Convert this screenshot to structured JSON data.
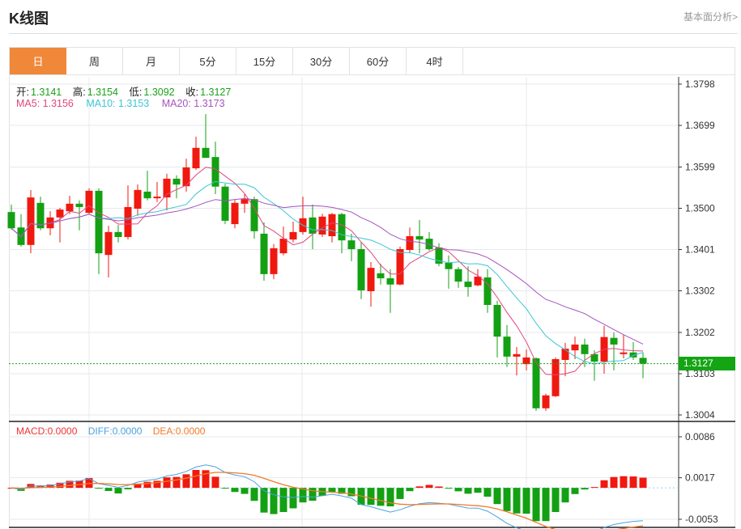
{
  "header": {
    "title": "K线图",
    "link": "基本面分析>"
  },
  "tabs": [
    {
      "label": "日",
      "active": true
    },
    {
      "label": "周"
    },
    {
      "label": "月"
    },
    {
      "label": "5分"
    },
    {
      "label": "15分"
    },
    {
      "label": "30分"
    },
    {
      "label": "60分"
    },
    {
      "label": "4时"
    }
  ],
  "ohlc_info": {
    "open_label": "开:",
    "open": "1.3141",
    "high_label": "高:",
    "high": "1.3154",
    "low_label": "低:",
    "low": "1.3092",
    "close_label": "收:",
    "close": "1.3127"
  },
  "ma_info": {
    "ma5": "MA5: 1.3156",
    "ma10": "MA10: 1.3153",
    "ma20": "MA20: 1.3173"
  },
  "macd_info": {
    "macd": "MACD:0.0000",
    "diff": "DIFF:0.0000",
    "dea": "DEA:0.0000"
  },
  "current_price": "1.3127",
  "colors": {
    "up": "#f0190f",
    "down": "#13a013",
    "ma5": "#e0467f",
    "ma10": "#3cc5d5",
    "ma20": "#a453c0",
    "diff": "#4aa3df",
    "dea": "#f07a2a",
    "active_tab": "#f0883a"
  },
  "chart_data": {
    "type": "candlestick",
    "price_axis_ticks": [
      "1.3798",
      "1.3699",
      "1.3599",
      "1.3500",
      "1.3401",
      "1.3302",
      "1.3202",
      "1.3103",
      "1.3004"
    ],
    "price_range": [
      1.3004,
      1.3798
    ],
    "macd_axis_ticks": [
      "0.0086",
      "0.0017",
      "-0.0053"
    ],
    "macd_range": [
      -0.0053,
      0.0086
    ],
    "candles_ohlc": [
      [
        1.3491,
        1.3509,
        1.3449,
        1.3452
      ],
      [
        1.3454,
        1.3486,
        1.3408,
        1.3412
      ],
      [
        1.3412,
        1.3544,
        1.3392,
        1.3526
      ],
      [
        1.3513,
        1.3528,
        1.3447,
        1.3452
      ],
      [
        1.3452,
        1.3493,
        1.3435,
        1.3478
      ],
      [
        1.3478,
        1.3501,
        1.3418,
        1.3497
      ],
      [
        1.3493,
        1.353,
        1.3486,
        1.3511
      ],
      [
        1.3511,
        1.3519,
        1.3447,
        1.3503
      ],
      [
        1.3489,
        1.3548,
        1.3486,
        1.3542
      ],
      [
        1.3542,
        1.3548,
        1.3342,
        1.3392
      ],
      [
        1.3388,
        1.3458,
        1.3334,
        1.3443
      ],
      [
        1.3443,
        1.346,
        1.3418,
        1.3431
      ],
      [
        1.3431,
        1.3555,
        1.3425,
        1.3503
      ],
      [
        1.3499,
        1.3557,
        1.3482,
        1.3544
      ],
      [
        1.354,
        1.359,
        1.3519,
        1.3524
      ],
      [
        1.3524,
        1.3563,
        1.3515,
        1.3528
      ],
      [
        1.3526,
        1.3583,
        1.3495,
        1.3571
      ],
      [
        1.3571,
        1.3579,
        1.3524,
        1.3557
      ],
      [
        1.3553,
        1.3619,
        1.354,
        1.3598
      ],
      [
        1.3596,
        1.3672,
        1.3592,
        1.3645
      ],
      [
        1.3645,
        1.3726,
        1.3621,
        1.3621
      ],
      [
        1.3623,
        1.366,
        1.3534,
        1.3552
      ],
      [
        1.3552,
        1.3559,
        1.3462,
        1.347
      ],
      [
        1.3462,
        1.352,
        1.3452,
        1.3513
      ],
      [
        1.3511,
        1.3534,
        1.3489,
        1.3522
      ],
      [
        1.3522,
        1.3528,
        1.3427,
        1.3445
      ],
      [
        1.3439,
        1.3466,
        1.3326,
        1.3342
      ],
      [
        1.3342,
        1.3414,
        1.333,
        1.3404
      ],
      [
        1.3392,
        1.3456,
        1.3387,
        1.3427
      ],
      [
        1.3425,
        1.3468,
        1.3418,
        1.3443
      ],
      [
        1.3443,
        1.3528,
        1.3437,
        1.3476
      ],
      [
        1.3478,
        1.3509,
        1.3402,
        1.3439
      ],
      [
        1.3437,
        1.3487,
        1.3431,
        1.348
      ],
      [
        1.3433,
        1.3489,
        1.3418,
        1.3486
      ],
      [
        1.3486,
        1.3489,
        1.3392,
        1.3423
      ],
      [
        1.3423,
        1.3439,
        1.3373,
        1.3402
      ],
      [
        1.3402,
        1.3418,
        1.3282,
        1.3303
      ],
      [
        1.3301,
        1.3371,
        1.3264,
        1.3357
      ],
      [
        1.3344,
        1.3367,
        1.3317,
        1.3332
      ],
      [
        1.3332,
        1.3354,
        1.3249,
        1.3317
      ],
      [
        1.3317,
        1.3408,
        1.3315,
        1.3402
      ],
      [
        1.34,
        1.3454,
        1.3392,
        1.3433
      ],
      [
        1.3433,
        1.3472,
        1.3392,
        1.3425
      ],
      [
        1.3427,
        1.3443,
        1.3398,
        1.3402
      ],
      [
        1.3406,
        1.3416,
        1.3361,
        1.3367
      ],
      [
        1.3369,
        1.3387,
        1.3307,
        1.3354
      ],
      [
        1.3354,
        1.3359,
        1.3309,
        1.3324
      ],
      [
        1.3324,
        1.3361,
        1.3288,
        1.3311
      ],
      [
        1.3315,
        1.3354,
        1.3313,
        1.3336
      ],
      [
        1.3334,
        1.3354,
        1.3249,
        1.3268
      ],
      [
        1.3268,
        1.3278,
        1.3142,
        1.3192
      ],
      [
        1.3192,
        1.322,
        1.3119,
        1.3144
      ],
      [
        1.3144,
        1.3167,
        1.3099,
        1.315
      ],
      [
        1.3126,
        1.3161,
        1.3111,
        1.3142
      ],
      [
        1.314,
        1.3142,
        1.3014,
        1.302
      ],
      [
        1.302,
        1.3055,
        1.3014,
        1.3051
      ],
      [
        1.3049,
        1.3142,
        1.3047,
        1.3138
      ],
      [
        1.3136,
        1.3177,
        1.3097,
        1.3163
      ],
      [
        1.3159,
        1.3192,
        1.3138,
        1.3173
      ],
      [
        1.3173,
        1.3187,
        1.3119,
        1.315
      ],
      [
        1.315,
        1.3159,
        1.3086,
        1.3132
      ],
      [
        1.3132,
        1.3218,
        1.3103,
        1.3191
      ],
      [
        1.3189,
        1.3202,
        1.3111,
        1.3173
      ],
      [
        1.315,
        1.3196,
        1.314,
        1.3154
      ],
      [
        1.3154,
        1.3179,
        1.3136,
        1.3142
      ],
      [
        1.3141,
        1.3154,
        1.3092,
        1.3127
      ]
    ]
  }
}
